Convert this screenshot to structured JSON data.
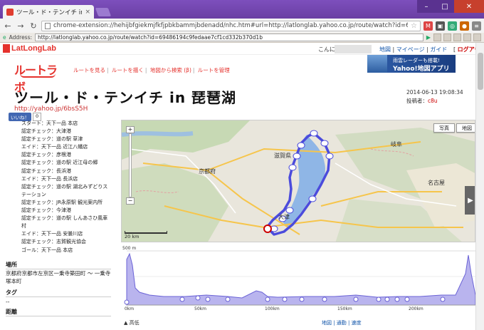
{
  "browser": {
    "tab_title": "ツール・ド・テンイチ in 琵琶湖",
    "url": "chrome-extension://hehijbfgiekmjfkfjpbkbammjbdenadd/nhc.htm#url=http://latlonglab.yahoo.co.jp/route/watch?id=6",
    "address_label": "Address:",
    "address_value": "http://latlonglab.yahoo.co.jp/route/watch?id=69486194c9fedaae7cf1cd332b370d1b"
  },
  "header": {
    "brand": "LatLongLab",
    "greeting": "こんに",
    "links": [
      "地図",
      "マイページ",
      "ガイド"
    ],
    "logout": "ログアウト"
  },
  "route_logo": "ルートラボ",
  "subnav": [
    "ルートを見る",
    "ルートを描く",
    "地図から検索 (β)",
    "ルートを管理"
  ],
  "ad": {
    "line1": "雨雲レーダーも搭載!",
    "line2": "Yahoo!地図アプリ"
  },
  "route": {
    "title": "ツール・ド・テンイチ in 琵琶湖",
    "date": "2014-06-13 19:08:34",
    "author_label": "投稿者：",
    "author": "c8u",
    "short_url": "http://yahoo.jp/6bsS5H"
  },
  "fb": {
    "like": "いいね！",
    "count": "0"
  },
  "checkpoints": [
    "スタート：天下一品 本店",
    "認定チェック：大津港",
    "認定チェック：道の駅 草津",
    "エイド：天下一品 近江八幡店",
    "認定チェック：彦根港",
    "認定チェック：道の駅 近江母の郷",
    "認定チェック：長浜港",
    "エイド：天下一品 長浜店",
    "認定チェック：道の駅 湖北みずどりス",
    "テーション",
    "認定チェック：JR永原駅 観光案内所",
    "認定チェック：今津港",
    "認定チェック：道の駅 しんあさひ風車",
    "村",
    "エイド：天下一品 安曇川店",
    "認定チェック：志賀観光協会",
    "ゴール：天下一品 本店"
  ],
  "sections": {
    "place_h": "場所",
    "place_v": "京都府京都市左京区一乗寺築田町 ～ 一乗寺塚本町",
    "tag_h": "タグ",
    "tag_v": "--",
    "dist_h": "距離"
  },
  "map": {
    "btn_photo": "写真",
    "btn_map": "地図",
    "labels": {
      "shiga": "滋賀県",
      "kyoto": "京都府",
      "gifu": "岐阜",
      "nagoya": "名古屋",
      "otsu": "大津"
    },
    "scale": "20 km"
  },
  "elevation": {
    "ymax_label": "500 m",
    "x_ticks": [
      "0km",
      "50km",
      "100km",
      "150km",
      "200km"
    ],
    "footer_left": "▲ 高低",
    "footer_right": "地図 | 通勤 | 速度"
  },
  "colors": {
    "route": "#4b4bdc",
    "accent": "#e5322d",
    "frame": "#6a3fa3"
  }
}
